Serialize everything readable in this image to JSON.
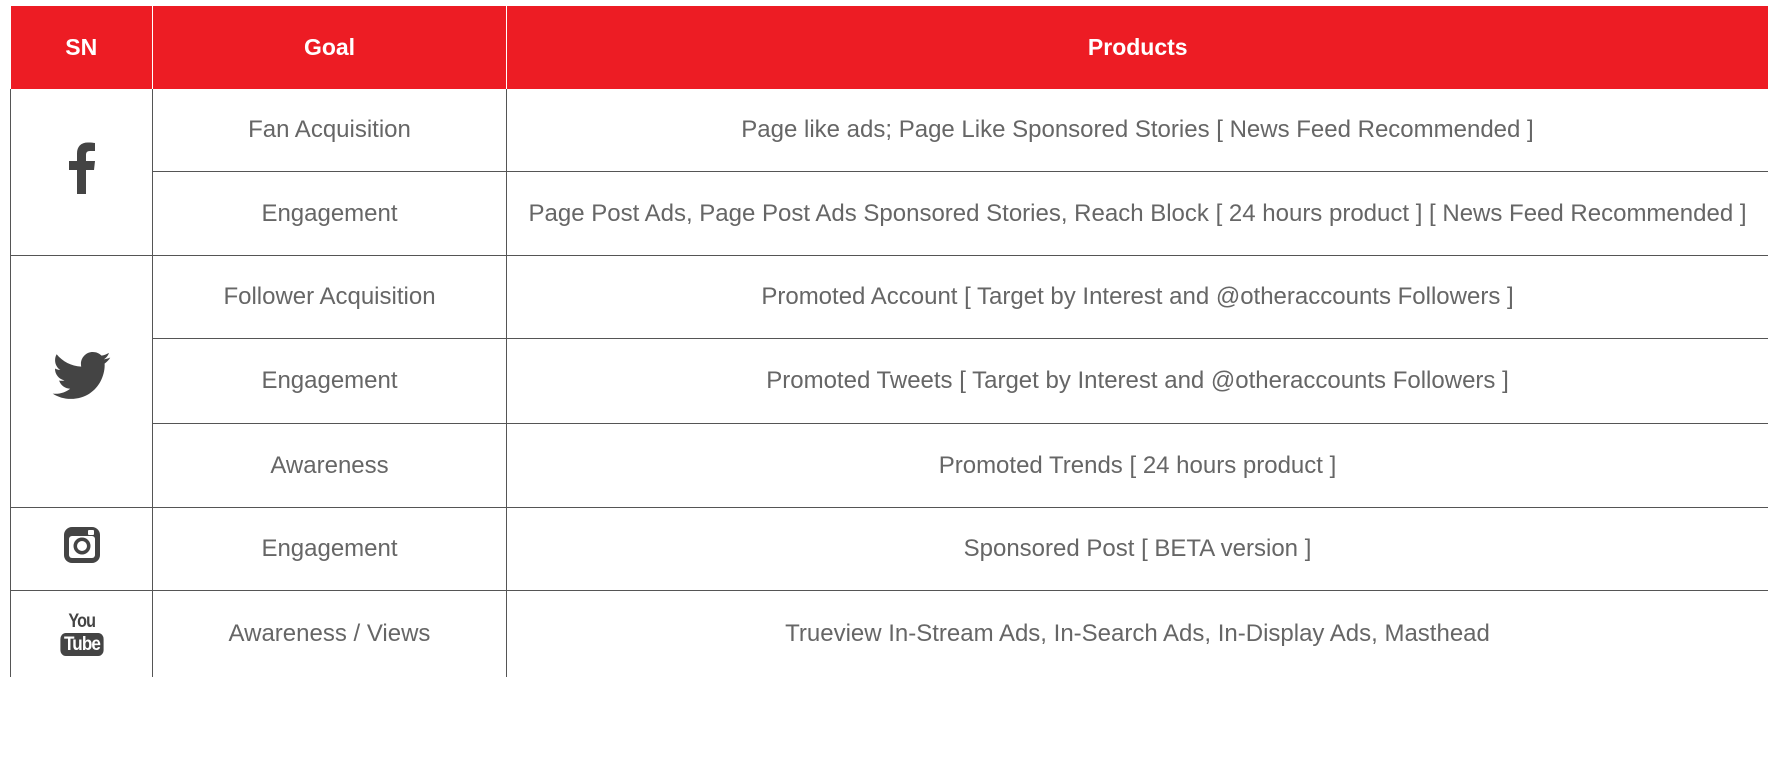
{
  "header": {
    "sn": "SN",
    "goal": "Goal",
    "products": "Products"
  },
  "colors": {
    "header_bg": "#ed1c24",
    "header_text": "#ffffff",
    "body_text": "#666666",
    "border": "#555555",
    "icon": "#444444"
  },
  "rows": [
    {
      "goal": "Fan Acquisition",
      "products": "Page like ads; Page Like Sponsored Stories [ News Feed Recommended ]"
    },
    {
      "goal": "Engagement",
      "products": "Page Post Ads, Page Post Ads Sponsored Stories, Reach Block [ 24 hours product ] [ News Feed Recommended ]"
    },
    {
      "goal": "Follower Acquisition",
      "products": "Promoted Account [ Target by Interest and @otheraccounts Followers ]"
    },
    {
      "goal": "Engagement",
      "products": "Promoted Tweets [ Target by Interest and @otheraccounts Followers ]"
    },
    {
      "goal": "Awareness",
      "products": "Promoted Trends [ 24 hours product ]"
    },
    {
      "goal": "Engagement",
      "products": "Sponsored Post [ BETA version ]"
    },
    {
      "goal": "Awareness / Views",
      "products": "Trueview In-Stream Ads, In-Search Ads, In-Display Ads, Masthead"
    }
  ],
  "networks": [
    {
      "icon": "facebook-icon"
    },
    {
      "icon": "twitter-icon"
    },
    {
      "icon": "instagram-icon"
    },
    {
      "icon": "youtube-icon",
      "logo_text_top": "You",
      "logo_text_bottom": "Tube"
    }
  ]
}
